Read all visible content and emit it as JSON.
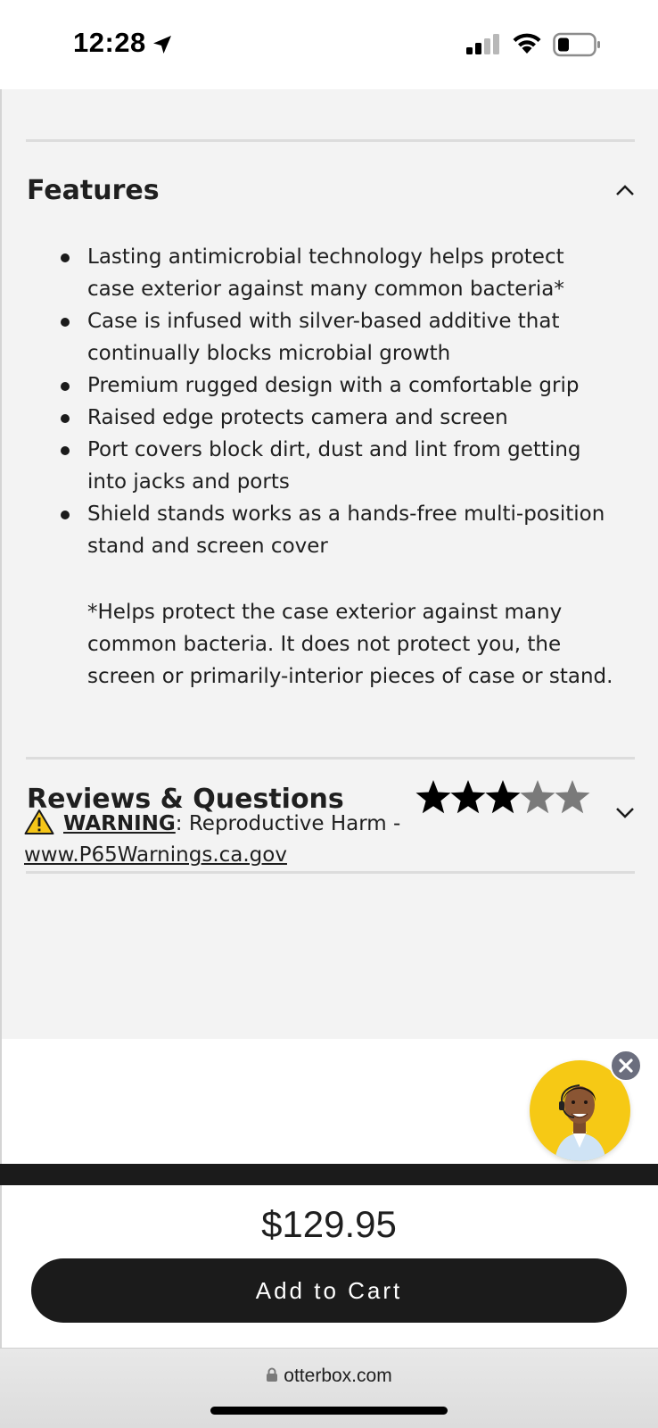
{
  "status_bar": {
    "time": "12:28",
    "icons": [
      "location-arrow-icon",
      "signal-icon",
      "wifi-icon",
      "battery-icon"
    ]
  },
  "features": {
    "title": "Features",
    "expanded": true,
    "items": [
      "Lasting antimicrobial technology helps protect case exterior against many common bacteria*",
      "Case is infused with silver-based additive that continually blocks microbial growth",
      "Premium rugged design with a comfortable grip",
      "Raised edge protects camera and screen",
      "Port covers block dirt, dust and lint from getting into jacks and ports",
      "Shield stands works as a hands-free multi-position stand and screen cover"
    ],
    "footnote": "*Helps protect the case exterior against many common bacteria. It does not protect you, the screen or primarily-interior pieces of case or stand."
  },
  "reviews": {
    "title": "Reviews & Questions",
    "rating": 3.5,
    "max_rating": 5,
    "expanded": false
  },
  "warning": {
    "label": "WARNING",
    "text": ": Reproductive Harm - ",
    "link": "www.P65Warnings.ca.gov"
  },
  "chat": {
    "avatar": "support-agent-avatar",
    "close_icon": "close-icon"
  },
  "purchase": {
    "price": "$129.95",
    "add_to_cart_label": "Add to Cart"
  },
  "browser": {
    "url": "otterbox.com"
  },
  "colors": {
    "content_bg": "#f3f3f3",
    "button_bg": "#1b1b1b",
    "chat_avatar_bg": "#f6c915",
    "warning_yellow": "#f5c518"
  }
}
